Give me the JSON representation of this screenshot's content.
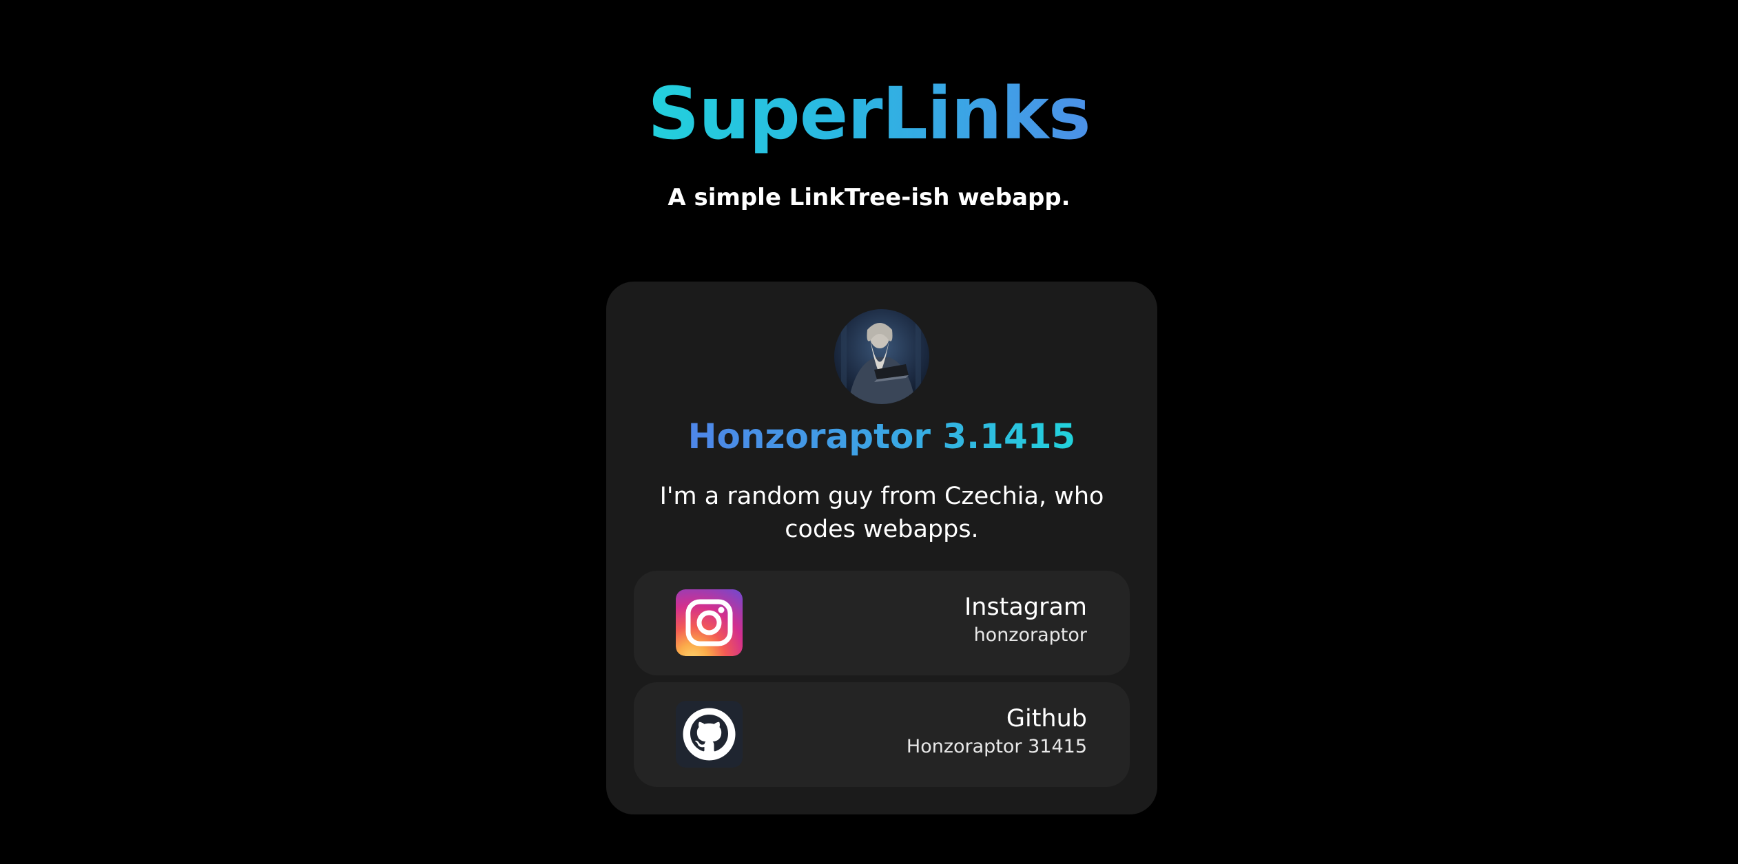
{
  "header": {
    "title": "SuperLinks",
    "subtitle": "A simple LinkTree-ish webapp."
  },
  "profile": {
    "name": "Honzoraptor 3.1415",
    "bio": "I'm a random guy from Czechia, who codes webapps."
  },
  "links": [
    {
      "title": "Instagram",
      "handle": "honzoraptor",
      "icon": "instagram-icon"
    },
    {
      "title": "Github",
      "handle": "Honzoraptor 31415",
      "icon": "github-icon"
    }
  ],
  "colors": {
    "background": "#000000",
    "card": "#1b1b1b",
    "link_item": "#242424",
    "accent_cyan": "#22d3dc",
    "accent_blue": "#4f86e8"
  }
}
